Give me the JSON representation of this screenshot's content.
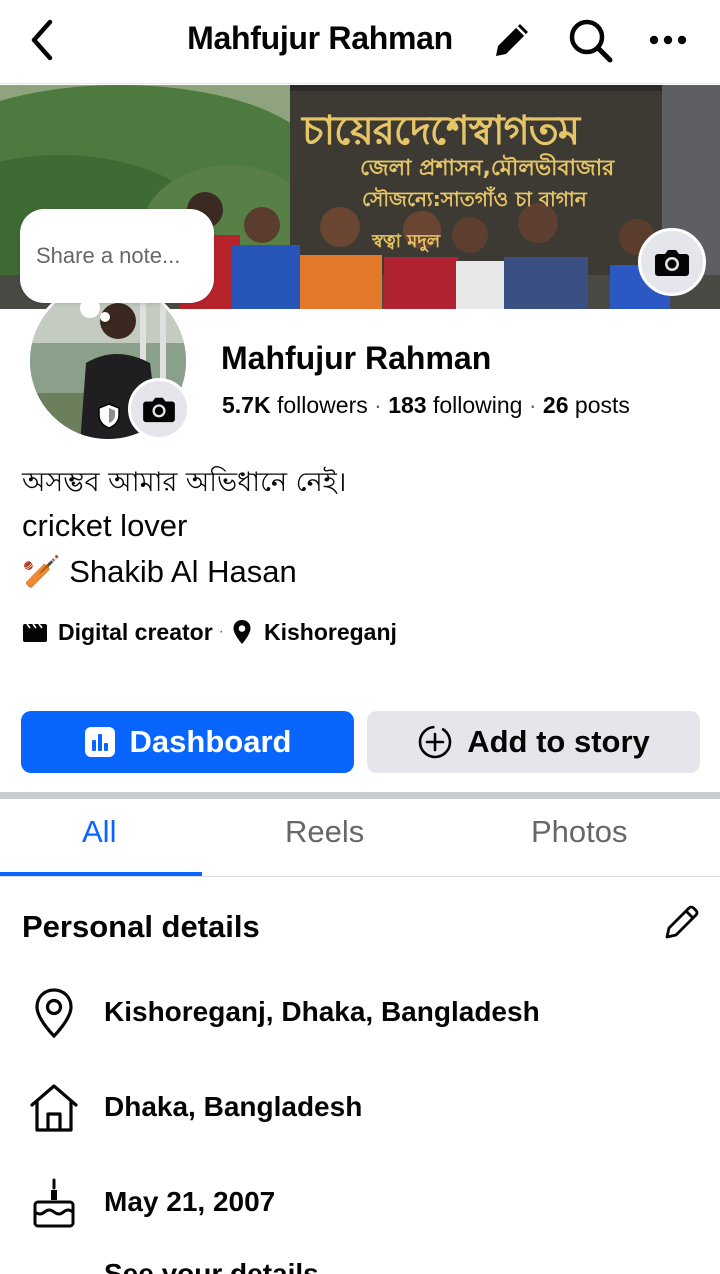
{
  "header": {
    "title": "Mahfujur Rahman",
    "icons": [
      "back-arrow-icon",
      "pencil-icon",
      "search-icon",
      "more-icon"
    ]
  },
  "cover": {
    "sign_line_1": "চায়েরদেশেস্বাগতম",
    "sign_line_2": "জেলা প্রশাসন,মৌলভীবাজার",
    "sign_line_3": "সৌজন্যে:সাতগাঁও চা বাগান",
    "sign_line_4": "স্বত্বা  মদুল"
  },
  "note": {
    "placeholder": "Share a note..."
  },
  "profile": {
    "name": "Mahfujur Rahman",
    "followers_count": "5.7K",
    "followers_label": "followers",
    "following_count": "183",
    "following_label": "following",
    "posts_count": "26",
    "posts_label": "posts",
    "separator": "·"
  },
  "bio": {
    "line_1": "অসম্ভব আমার অভিধানে নেই।",
    "line_2": "cricket lover",
    "line_3_emoji": "🏏",
    "line_3": "Shakib Al Hasan"
  },
  "meta": {
    "category": "Digital creator",
    "location": "Kishoreganj",
    "separator": "·"
  },
  "actions": {
    "dashboard_label": "Dashboard",
    "add_story_label": "Add to story"
  },
  "tabs": [
    {
      "label": "All",
      "active": true
    },
    {
      "label": "Reels",
      "active": false
    },
    {
      "label": "Photos",
      "active": false
    }
  ],
  "personal_details": {
    "title": "Personal details",
    "items": [
      {
        "icon": "location-pin-icon",
        "text": "Kishoreganj, Dhaka, Bangladesh"
      },
      {
        "icon": "home-icon",
        "text": "Dhaka, Bangladesh"
      },
      {
        "icon": "birthday-cake-icon",
        "text": "May 21, 2007"
      }
    ],
    "partial_text": "See your details"
  },
  "colors": {
    "primary": "#0866ff",
    "secondary_button": "#e4e6eb",
    "muted_text": "#65676b",
    "text": "#050505"
  }
}
